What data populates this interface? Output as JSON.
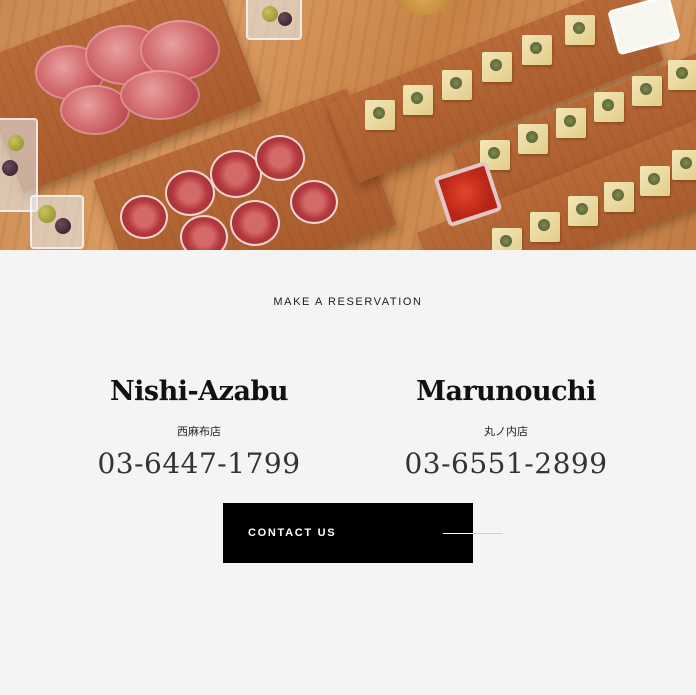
{
  "reservation": {
    "heading": "MAKE A RESERVATION",
    "locations": [
      {
        "name": "Nishi-Azabu",
        "name_jp": "西麻布店",
        "phone": "03-6447-1799"
      },
      {
        "name": "Marunouchi",
        "name_jp": "丸ノ内店",
        "phone": "03-6551-2899"
      }
    ],
    "contact_button": {
      "label": "CONTACT US"
    }
  },
  "colors": {
    "background": "#f5f4f2",
    "button_bg": "#000000",
    "button_text": "#ffffff",
    "heading_text": "#111111"
  },
  "hero": {
    "icon": "food-photo",
    "description_hidden": ""
  }
}
